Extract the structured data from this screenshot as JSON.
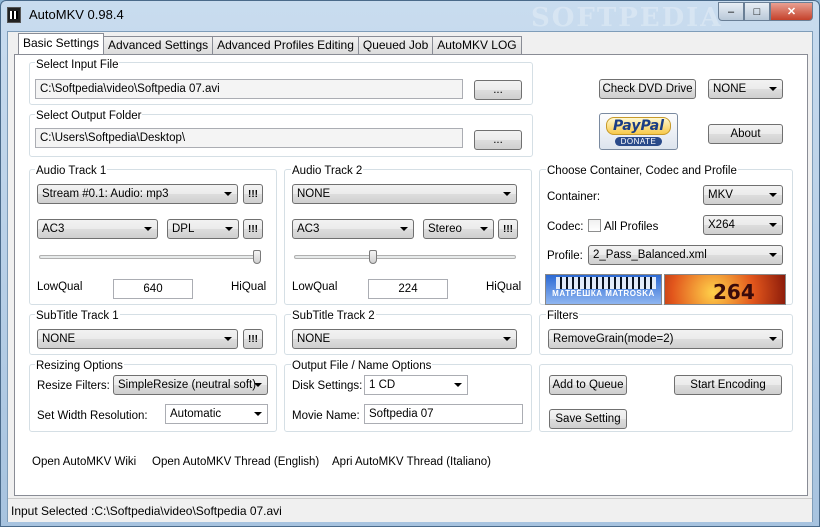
{
  "window": {
    "title": "AutoMKV 0.98.4",
    "watermark": "SOFTPEDIA"
  },
  "caption": {
    "minimize": "–",
    "maximize": "□",
    "close": "✕"
  },
  "tabs": [
    {
      "label": "Basic Settings"
    },
    {
      "label": "Advanced Settings"
    },
    {
      "label": "Advanced Profiles Editing"
    },
    {
      "label": "Queued Job"
    },
    {
      "label": "AutoMKV LOG"
    }
  ],
  "input": {
    "label": "Select Input File",
    "value": "C:\\Softpedia\\video\\Softpedia 07.avi",
    "browse": "..."
  },
  "output": {
    "label": "Select Output Folder",
    "value": "C:\\Users\\Softpedia\\Desktop\\",
    "browse": "..."
  },
  "dvd": {
    "check_label": "Check DVD Drive",
    "drive": "NONE"
  },
  "paypal": {
    "brand": "PayPal",
    "donate": "DONATE"
  },
  "about_label": "About",
  "audio1": {
    "label": "Audio Track 1",
    "stream": "Stream #0.1: Audio: mp3",
    "codec": "AC3",
    "mode": "DPL",
    "alert": "!!!",
    "low": "LowQual",
    "high": "HiQual",
    "bitrate": "640",
    "slider_fraction": 1.0
  },
  "audio2": {
    "label": "Audio Track 2",
    "stream": "NONE",
    "codec": "AC3",
    "mode": "Stereo",
    "alert": "!!!",
    "low": "LowQual",
    "high": "HiQual",
    "bitrate": "224",
    "slider_fraction": 0.35
  },
  "container": {
    "label": "Choose Container, Codec and Profile",
    "container_label": "Container:",
    "container": "MKV",
    "codec_label": "Codec:",
    "all_profiles": "All Profiles",
    "codec": "X264",
    "profile_label": "Profile:",
    "profile": "2_Pass_Balanced.xml"
  },
  "logos": {
    "matroska": "МАТРЁШКА MATROSKA",
    "x264": "264"
  },
  "subtitle1": {
    "label": "SubTitle Track 1",
    "value": "NONE",
    "alert": "!!!"
  },
  "subtitle2": {
    "label": "SubTitle Track 2",
    "value": "NONE"
  },
  "filters": {
    "label": "Filters",
    "value": "RemoveGrain(mode=2)"
  },
  "resize": {
    "label": "Resizing Options",
    "filters_label": "Resize Filters:",
    "filter": "SimpleResize (neutral soft)",
    "width_label": "Set Width Resolution:",
    "width": "Automatic"
  },
  "outfile": {
    "label": "Output File / Name Options",
    "disk_label": "Disk Settings:",
    "disk": "1 CD",
    "movie_label": "Movie Name:",
    "movie": "Softpedia 07"
  },
  "actions": {
    "add_queue": "Add to Queue",
    "start": "Start Encoding",
    "save": "Save Setting"
  },
  "links": {
    "wiki": "Open AutoMKV Wiki",
    "thread_en": "Open AutoMKV Thread (English)",
    "thread_it": "Apri AutoMKV Thread (Italiano)"
  },
  "status": "Input Selected :C:\\Softpedia\\video\\Softpedia 07.avi"
}
